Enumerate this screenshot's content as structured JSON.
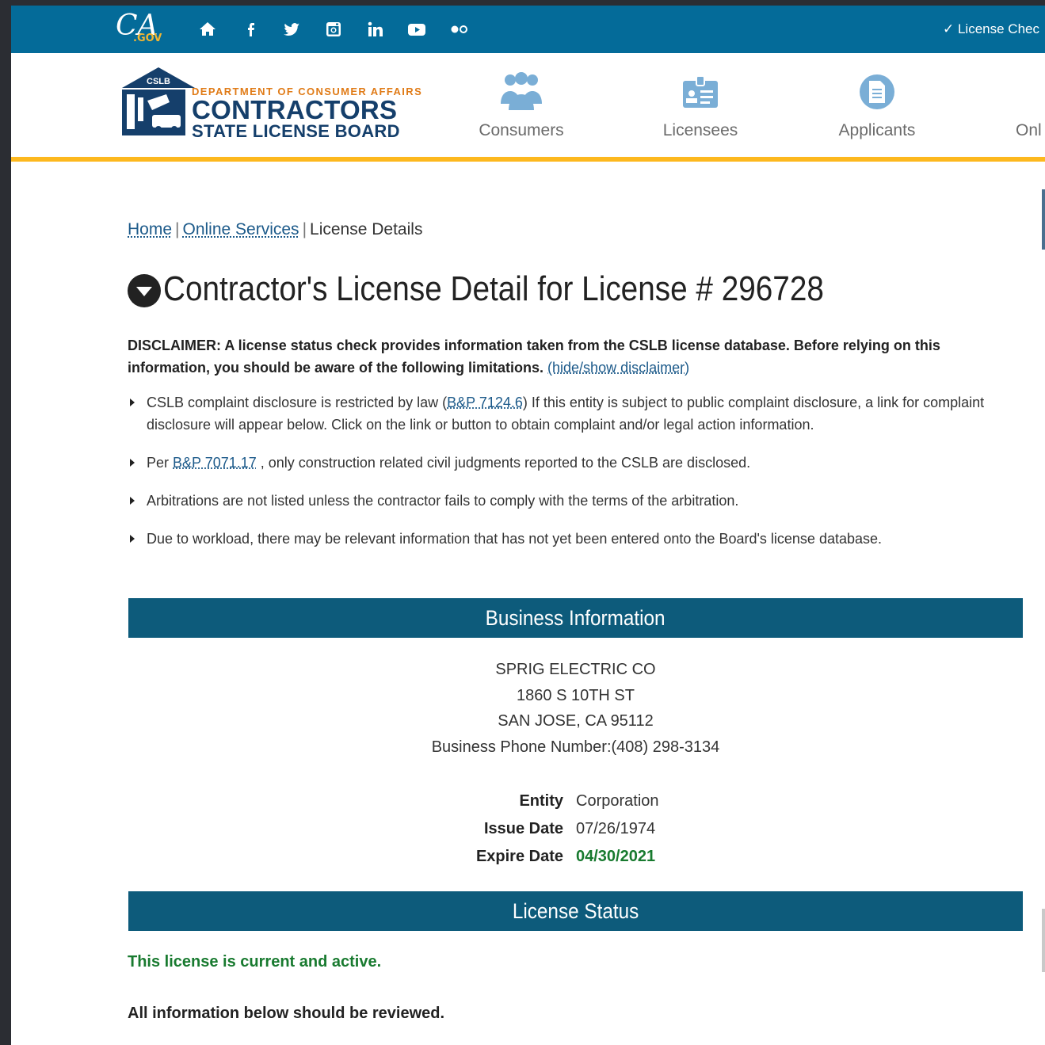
{
  "topbar": {
    "cagov_ca": "CA",
    "cagov_gov": ".GOV",
    "social_icons": [
      "home-icon",
      "facebook-icon",
      "twitter-icon",
      "instagram-icon",
      "linkedin-icon",
      "youtube-icon",
      "flickr-icon"
    ],
    "license_check": "✓ License Chec"
  },
  "header": {
    "logo_badge": "CSLB",
    "dept": "DEPARTMENT OF CONSUMER AFFAIRS",
    "contractors": "CONTRACTORS",
    "board": "STATE LICENSE BOARD",
    "nav": [
      {
        "label": "Consumers",
        "icon": "people-icon"
      },
      {
        "label": "Licensees",
        "icon": "id-badge-icon"
      },
      {
        "label": "Applicants",
        "icon": "document-icon"
      },
      {
        "label": "Onl",
        "icon": ""
      }
    ]
  },
  "breadcrumb": {
    "home": "Home",
    "sep1": "|",
    "online_services": "Online Services",
    "sep2": "|",
    "current": "License Details"
  },
  "title": "Contractor's License Detail for License # 296728",
  "disclaimer": {
    "text": "DISCLAIMER: A license status check provides information taken from the CSLB license database. Before relying on this information, you should be aware of the following limitations.",
    "toggle_link": "(hide/show disclaimer)"
  },
  "bullets": {
    "b1_pre": "CSLB complaint disclosure is restricted by law (",
    "b1_link": "B&P 7124.6",
    "b1_post": ") If this entity is subject to public complaint disclosure, a link for complaint disclosure will appear below. Click on the link or button to obtain complaint and/or legal action information.",
    "b2_pre": "Per ",
    "b2_link": "B&P 7071.17",
    "b2_post": " , only construction related civil judgments reported to the CSLB are disclosed.",
    "b3": "Arbitrations are not listed unless the contractor fails to comply with the terms of the arbitration.",
    "b4": "Due to workload, there may be relevant information that has not yet been entered onto the Board's license database."
  },
  "business": {
    "section_title": "Business Information",
    "name": "SPRIG ELECTRIC CO",
    "street": "1860 S 10TH ST",
    "city": "SAN JOSE, CA 95112",
    "phone": "Business Phone Number:(408) 298-3134",
    "entity_label": "Entity",
    "entity_value": "Corporation",
    "issue_label": "Issue Date",
    "issue_value": "07/26/1974",
    "expire_label": "Expire Date",
    "expire_value": "04/30/2021"
  },
  "license_status": {
    "section_title": "License Status",
    "status_message": "This license is current and active.",
    "review_message": "All information below should be reviewed."
  },
  "colors": {
    "topbar": "#046b99",
    "accent_bar": "#fdb81e",
    "section_bar": "#0d5b7b",
    "active_green": "#187a2f",
    "link": "#1c5a8a"
  }
}
